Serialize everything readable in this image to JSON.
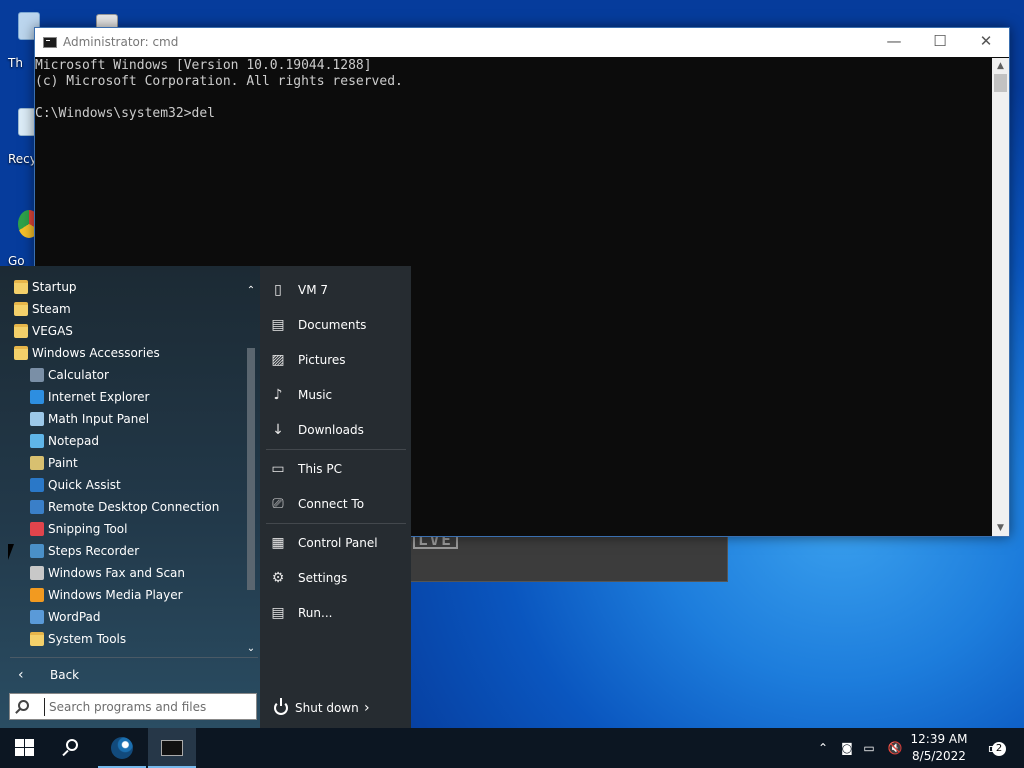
{
  "desktop": {
    "icons": [
      {
        "label": "Th",
        "icon": "this-pc-icon"
      },
      {
        "label": "Recy",
        "icon": "recycle-bin-icon"
      },
      {
        "label": "Go",
        "icon": "chrome-icon"
      }
    ]
  },
  "cmd_window": {
    "title": "Administrator: cmd",
    "lines": [
      "Microsoft Windows [Version 10.0.19044.1288]",
      "(c) Microsoft Corporation. All rights reserved.",
      "",
      "C:\\Windows\\system32>del"
    ],
    "minimize_label": "—",
    "maximize_label": "☐",
    "close_label": "✕"
  },
  "background_window": {
    "logo_text": "LVE"
  },
  "start_menu": {
    "programs": [
      {
        "label": "Startup",
        "type": "folder",
        "indent": 0
      },
      {
        "label": "Steam",
        "type": "folder",
        "indent": 0
      },
      {
        "label": "VEGAS",
        "type": "folder",
        "indent": 0
      },
      {
        "label": "Windows Accessories",
        "type": "folder",
        "indent": 0
      },
      {
        "label": "Calculator",
        "type": "app",
        "indent": 1,
        "icon": "calculator-icon",
        "color": "#7a8fa6"
      },
      {
        "label": "Internet Explorer",
        "type": "app",
        "indent": 1,
        "icon": "internet-explorer-icon",
        "color": "#2d8ee0"
      },
      {
        "label": "Math Input Panel",
        "type": "app",
        "indent": 1,
        "icon": "math-input-icon",
        "color": "#9cc8e8"
      },
      {
        "label": "Notepad",
        "type": "app",
        "indent": 1,
        "icon": "notepad-icon",
        "color": "#5fb5e8"
      },
      {
        "label": "Paint",
        "type": "app",
        "indent": 1,
        "icon": "paint-icon",
        "color": "#d8c070"
      },
      {
        "label": "Quick Assist",
        "type": "app",
        "indent": 1,
        "icon": "quick-assist-icon",
        "color": "#2a78c8"
      },
      {
        "label": "Remote Desktop Connection",
        "type": "app",
        "indent": 1,
        "icon": "remote-desktop-icon",
        "color": "#3a7fc8"
      },
      {
        "label": "Snipping Tool",
        "type": "app",
        "indent": 1,
        "icon": "snipping-tool-icon",
        "color": "#e0444c"
      },
      {
        "label": "Steps Recorder",
        "type": "app",
        "indent": 1,
        "icon": "steps-recorder-icon",
        "color": "#4a90c8"
      },
      {
        "label": "Windows Fax and Scan",
        "type": "app",
        "indent": 1,
        "icon": "fax-scan-icon",
        "color": "#c8c8c8"
      },
      {
        "label": "Windows Media Player",
        "type": "app",
        "indent": 1,
        "icon": "media-player-icon",
        "color": "#f29a20"
      },
      {
        "label": "WordPad",
        "type": "app",
        "indent": 1,
        "icon": "wordpad-icon",
        "color": "#5a9ad8"
      },
      {
        "label": "System Tools",
        "type": "folder",
        "indent": 1
      }
    ],
    "back_label": "Back",
    "search_placeholder": "Search programs and files",
    "right_items_group1": [
      {
        "label": "VM 7",
        "icon": "user-folder-icon",
        "glyph": "▯"
      },
      {
        "label": "Documents",
        "icon": "documents-icon",
        "glyph": "▤"
      },
      {
        "label": "Pictures",
        "icon": "pictures-icon",
        "glyph": "▨"
      },
      {
        "label": "Music",
        "icon": "music-icon",
        "glyph": "♪"
      },
      {
        "label": "Downloads",
        "icon": "downloads-icon",
        "glyph": "↓"
      }
    ],
    "right_items_group2": [
      {
        "label": "This PC",
        "icon": "computer-icon",
        "glyph": "▭"
      },
      {
        "label": "Connect To",
        "icon": "connect-to-icon",
        "glyph": "⎚"
      }
    ],
    "right_items_group3": [
      {
        "label": "Control Panel",
        "icon": "control-panel-icon",
        "glyph": "▦"
      },
      {
        "label": "Settings",
        "icon": "gear-icon",
        "glyph": "⚙"
      },
      {
        "label": "Run...",
        "icon": "run-icon",
        "glyph": "▤"
      }
    ],
    "shutdown_label": "Shut down"
  },
  "taskbar": {
    "time": "12:39 AM",
    "date": "8/5/2022",
    "notification_count": "2"
  }
}
